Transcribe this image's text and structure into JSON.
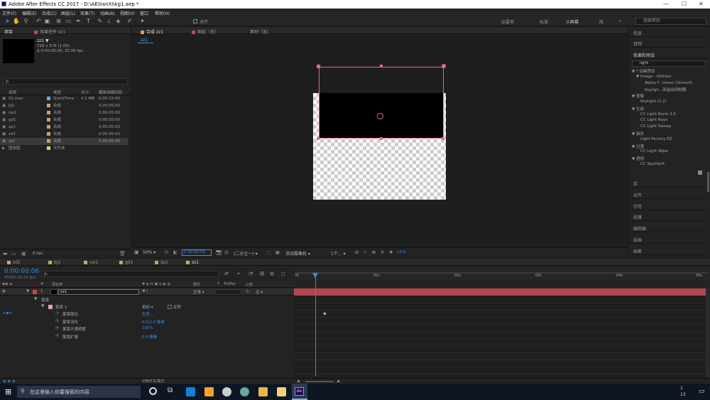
{
  "window": {
    "title": "Adobe After Effects CC 2017 - D:\\AE\\lianXi\\kg1.aep *",
    "minimize": "—",
    "maximize": "☐",
    "close": "✕",
    "app_badge": "Ae"
  },
  "menu": [
    "文件(F)",
    "编辑(E)",
    "合成(C)",
    "图层(L)",
    "效果(T)",
    "动画(A)",
    "视图(V)",
    "窗口",
    "帮助(H)"
  ],
  "toolbar": {
    "align_label": "对齐",
    "workspaces": [
      "必要项",
      "标准",
      "小屏幕",
      "库"
    ],
    "search_placeholder": "搜索帮助",
    "more": "»"
  },
  "project_panel": {
    "tab": "项目",
    "effect_tab": "效果控件 zz1",
    "selected_name": "zz1 ▼",
    "selected_info1": "720 x 576 (1.09)",
    "selected_info2": "Δ 0:00:05:00, 25.00 fps",
    "search_icon_label": "ρ.",
    "columns": [
      "名称",
      "类型",
      "大小",
      "媒体持续时间"
    ],
    "items": [
      {
        "name": "01.mov",
        "type": "QuickTime",
        "size": "4.1 MB",
        "dur": "0:00:15:00",
        "color": "#6fb0c9"
      },
      {
        "name": "bj1",
        "type": "合成",
        "size": "",
        "dur": "0:00:05:00",
        "color": "#c8a46a"
      },
      {
        "name": "cw1",
        "type": "合成",
        "size": "",
        "dur": "0:00:05:00",
        "color": "#c8a46a"
      },
      {
        "name": "gd1",
        "type": "合成",
        "size": "",
        "dur": "0:00:05:00",
        "color": "#c8a46a"
      },
      {
        "name": "sp1",
        "type": "合成",
        "size": "",
        "dur": "0:00:05:00",
        "color": "#c8a46a"
      },
      {
        "name": "zd1",
        "type": "合成",
        "size": "",
        "dur": "0:00:05:00",
        "color": "#c8a46a"
      },
      {
        "name": "zz1",
        "type": "合成",
        "size": "",
        "dur": "0:00:05:00",
        "color": "#c8a46a"
      },
      {
        "name": "固态层",
        "type": "文件夹",
        "size": "",
        "dur": "",
        "color": "#e3d16c"
      }
    ],
    "bpc": "8 bpc"
  },
  "composition_panel": {
    "tabs": [
      "合成 zz1",
      "图层（无）",
      "素材（无）"
    ],
    "sub_tab": "zz1",
    "footer": {
      "zoom": "50%",
      "time": "0:00:00:06",
      "resolution": "(二分之一)",
      "camera": "活动摄像机",
      "views": "1个...",
      "offset": "+0.0"
    }
  },
  "right_panel": {
    "items_top": [
      "信息",
      "音频"
    ],
    "effects_title": "效果和预设",
    "search": "light",
    "tree": [
      {
        "text": "▼ * 动画预设",
        "indent": 0
      },
      {
        "text": "▼ Image - Utilities",
        "indent": 1
      },
      {
        "text": "Alpha F...ltness (Unmult)",
        "indent": 3
      },
      {
        "text": "Keyligh...回溢出抑制器",
        "indent": 3
      },
      {
        "text": "▼ 抠像",
        "indent": 0
      },
      {
        "text": "Keylight (1.2)",
        "indent": 2
      },
      {
        "text": "▼ 生成",
        "indent": 0
      },
      {
        "text": "CC Light Burst 2.5",
        "indent": 2
      },
      {
        "text": "CC Light Rays",
        "indent": 2
      },
      {
        "text": "CC Light Sweep",
        "indent": 2
      },
      {
        "text": "▼ 缺失",
        "indent": 0
      },
      {
        "text": "Light Factory EZ",
        "indent": 2
      },
      {
        "text": "▼ 过渡",
        "indent": 0
      },
      {
        "text": "CC Light Wipe",
        "indent": 2
      },
      {
        "text": "▼ 透视",
        "indent": 0
      },
      {
        "text": "CC Spotlight",
        "indent": 2
      }
    ],
    "items_bottom": [
      "库",
      "对齐",
      "字符",
      "段落",
      "跟踪器",
      "绘画",
      "画笔"
    ]
  },
  "timeline": {
    "comp_tabs": [
      "zd1",
      "bj1",
      "cw1",
      "gd1",
      "sp1",
      "zz1"
    ],
    "current_time": "0:00:00:06",
    "fps_info": "00006 (25.00 fps)",
    "search_icon_label": "ρ.",
    "header": {
      "num": "#",
      "source": "源名称",
      "mode": "模式",
      "t": "T",
      "trkmat": "TrkMat",
      "parent": "父级"
    },
    "layer": {
      "num": "1",
      "name": "zz1",
      "mode": "正常",
      "parent": "无"
    },
    "mask_group": "蒙版",
    "mask_name": "蒙版 1",
    "mask_mode": "相加",
    "mask_invert": "反转",
    "mask_props": [
      {
        "name": "蒙版路径",
        "value": "形状..."
      },
      {
        "name": "蒙版羽化",
        "value": "0.0,0.0 像素"
      },
      {
        "name": "蒙版不透明度",
        "value": "100%"
      },
      {
        "name": "蒙版扩展",
        "value": "0.0 像素"
      }
    ],
    "ruler": [
      "0f",
      "01s",
      "02s",
      "03s",
      "04s",
      "05s"
    ],
    "switch_label": "切换开关/模式"
  },
  "taskbar": {
    "search_placeholder": "在这里输入你要搜索的内容",
    "clock_time": "1",
    "clock_date": "13"
  },
  "colors": {
    "accent": "#2d8ceb",
    "layer_bar": "#b5464f",
    "mask_path": "#e36b7a",
    "canvas_bg": "#1e1e1e"
  }
}
